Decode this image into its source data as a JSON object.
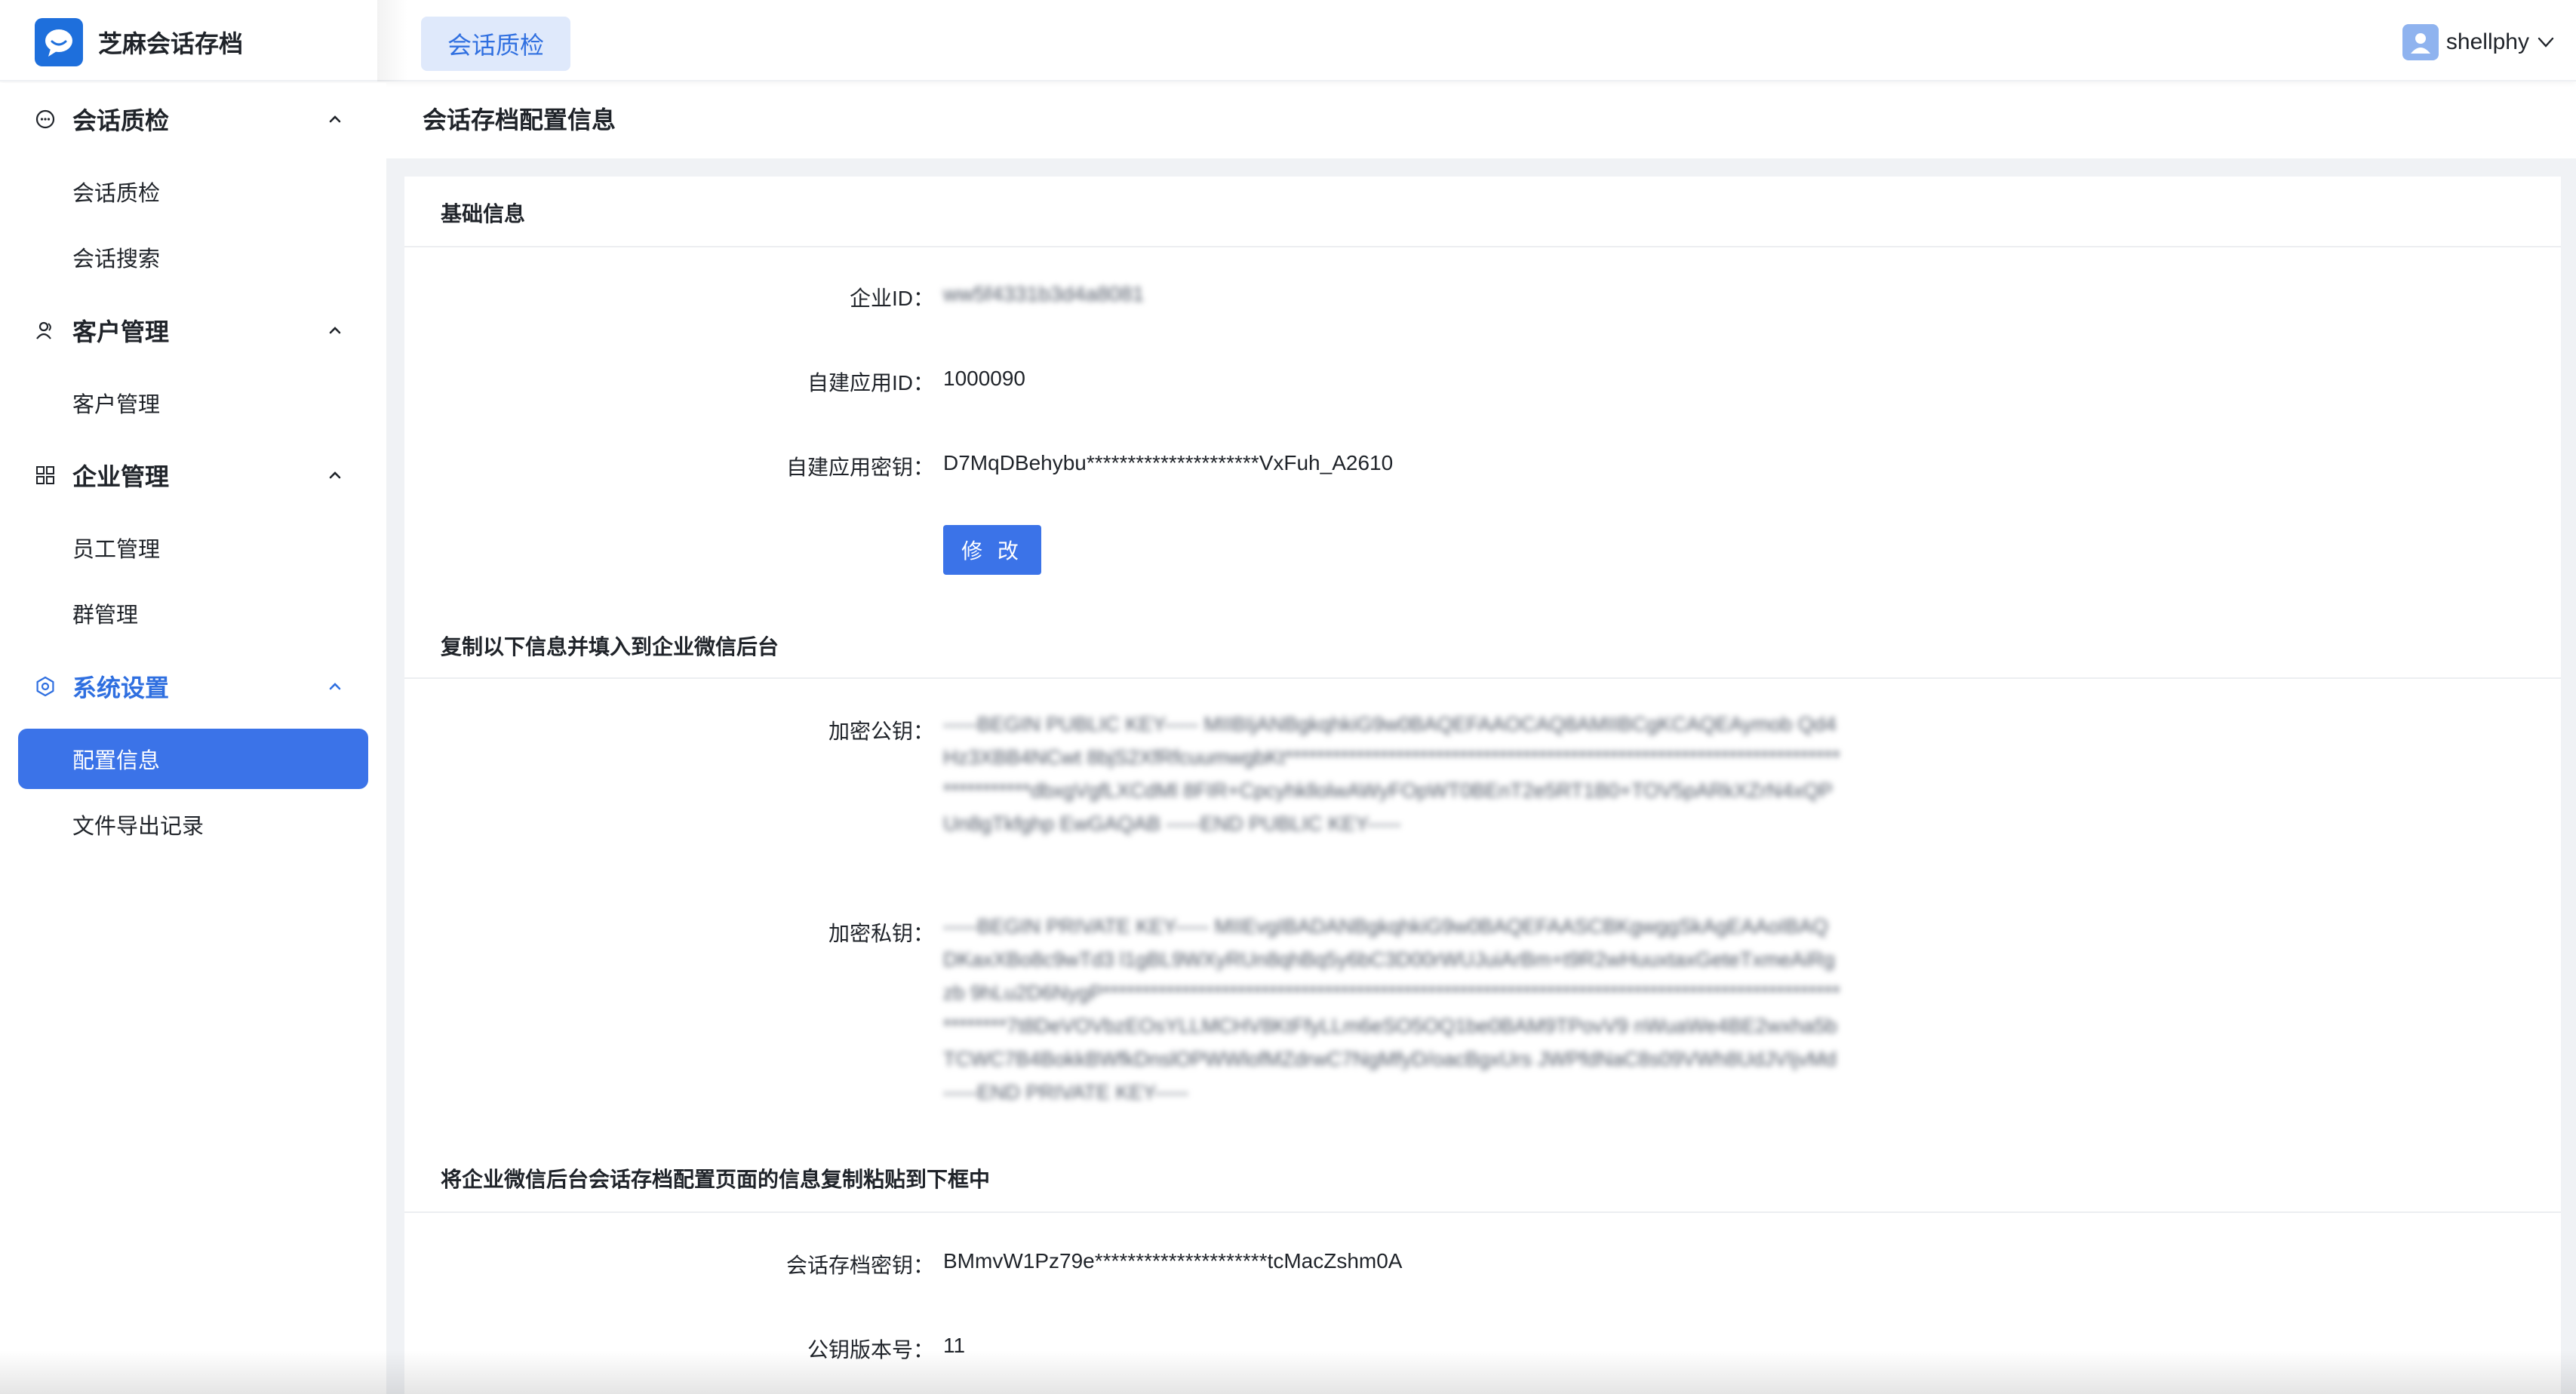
{
  "app": {
    "name": "芝麻会话存档",
    "logo_icon": "chat-bubble-icon",
    "brand_color": "#1e6fdc"
  },
  "header": {
    "active_tab": "会话质检",
    "user_name": "shellphy"
  },
  "sidebar": {
    "groups": [
      {
        "title": "会话质检",
        "icon": "chat-icon",
        "items": [
          "会话质检",
          "会话搜索"
        ]
      },
      {
        "title": "客户管理",
        "icon": "user-icon",
        "items": [
          "客户管理"
        ]
      },
      {
        "title": "企业管理",
        "icon": "grid-icon",
        "items": [
          "员工管理",
          "群管理"
        ]
      },
      {
        "title": "系统设置",
        "icon": "gear-icon",
        "items": [
          "配置信息",
          "文件导出记录"
        ],
        "active": true
      }
    ],
    "active_item": "配置信息",
    "accent_color": "#3b73e8"
  },
  "main": {
    "page_title": "会话存档配置信息",
    "basic": {
      "title": "基础信息",
      "corp_id_label": "企业ID：",
      "corp_id_value": "ww5f4331b3d4a8081",
      "app_id_label": "自建应用ID：",
      "app_id_value": "1000090",
      "app_secret_label": "自建应用密钥：",
      "app_secret_value": "D7MqDBehybu*********************VxFuh_A2610",
      "edit_button": "修 改"
    },
    "copy_section": {
      "title": "复制以下信息并填入到企业微信后台",
      "public_key_label": "加密公钥：",
      "public_key_value": "-----BEGIN PUBLIC KEY----- MIIBIjANBgkqhkiG9w0BAQEFAAOCAQ8AMIIBCgKCAQEAymob Qd4Hz3XBB4NCwt 8bjS2XfRfcuumwgbKt*********************************************************************************dbxgVgfLXCdMl 8FIR+CpcyhkllolwAWyFOpWT0BEnT2e5RT1B0+TOV5pARkXZrN4xQPUn8gTkfghp EwGAQAB -----END PUBLIC KEY-----",
      "private_key_label": "加密私钥：",
      "private_key_value": "-----BEGIN PRIVATE KEY----- MIIEvgIBADANBgkqhkiG9w0BAQEFAASCBKgwggSkAgEAAoIBAQDKaxXBo8c9wTd3 l1gBL9WXyRUn8qhBq5y6bC3D00rWUJuiArBm+t9R2wHuuxtaxGeteTxmeAiRgzb 9hLu2D6NygP*****************************************************************************************************7t8DeVOVbzEOsYLLMCHV8KtFfyLLm6eSO5OQ1be0BAM9TPovV9 nWuaWe4BE2wxha5bTCWC7B4BokkBWfkDnslOPWWlofMZdrwC7NgMfyD/oacBgxUrs JWPfdNaC8s09VWh8UdJVIjvMd -----END PRIVATE KEY-----"
    },
    "paste_section": {
      "title": "将企业微信后台会话存档配置页面的信息复制粘贴到下框中",
      "archive_secret_label": "会话存档密钥：",
      "archive_secret_value": "BMmvW1Pz79e*********************tcMacZshm0A",
      "key_version_label": "公钥版本号：",
      "key_version_value": "11"
    }
  }
}
